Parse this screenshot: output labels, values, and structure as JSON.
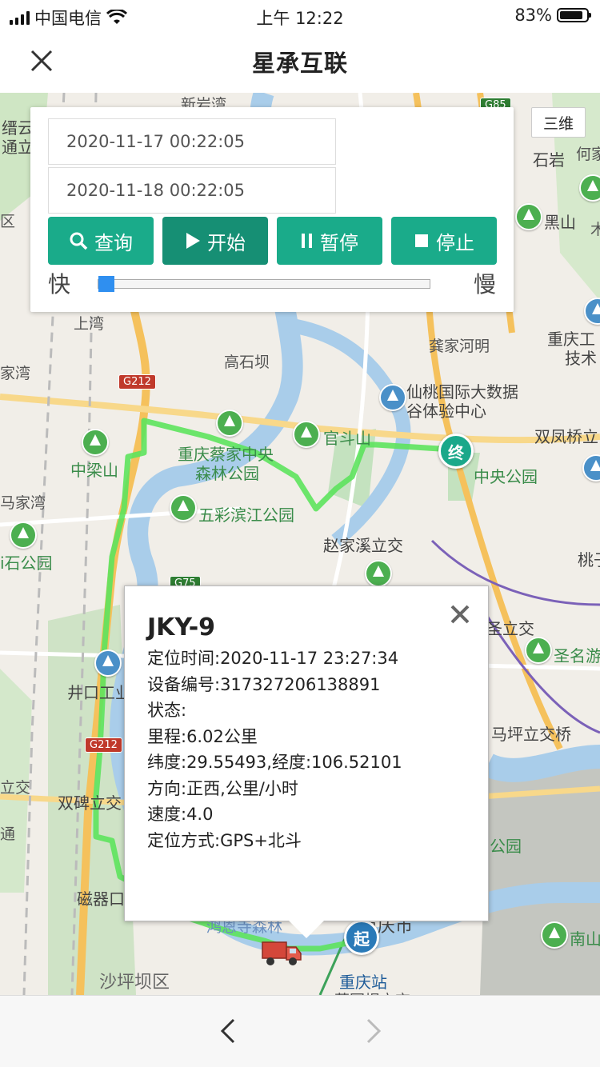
{
  "status_bar": {
    "carrier": "中国电信",
    "time": "上午 12:22",
    "battery": "83%"
  },
  "nav": {
    "title": "星承互联"
  },
  "map": {
    "labels": [
      "新岩湾",
      "缙云",
      "通立",
      "区",
      "上湾",
      "家湾",
      "高石坝",
      "龚家河明",
      "仙桃国际大数据",
      "谷体验中心",
      "双凤桥立",
      "重庆工",
      "技术",
      "石岩",
      "何家",
      "黑山",
      "木",
      "重庆蔡家中央",
      "森林公园",
      "官斗山",
      "中央公园",
      "中梁山",
      "马家湾",
      "五彩滨江公园",
      "赵家溪立交",
      "桃子",
      "i石公园",
      "井口工业",
      "圣名游",
      "马坪立交桥",
      "双碑立交",
      "磁器口",
      "公园",
      "南山",
      "重庆站",
      "沙坪坝区",
      "圣立交",
      "立交",
      "通",
      "鸿恩寺森林",
      "重庆市",
      "菜园坝立交"
    ],
    "road_tags": [
      "G85",
      "G212",
      "G75",
      "G212"
    ],
    "three_d_button": "三维",
    "start_marker": "起",
    "end_marker": "终"
  },
  "controls": {
    "start_time": "2020-11-17 00:22:05",
    "end_time": "2020-11-18 00:22:05",
    "buttons": [
      {
        "label": "查询",
        "icon": "search-icon"
      },
      {
        "label": "开始",
        "icon": "play-icon"
      },
      {
        "label": "暂停",
        "icon": "pause-icon"
      },
      {
        "label": "停止",
        "icon": "stop-icon"
      }
    ],
    "speed_fast": "快",
    "speed_slow": "慢",
    "speed_value": 0
  },
  "popup": {
    "title": "JKY-9",
    "lines": [
      "定位时间:2020-11-17 23:27:34",
      "设备编号:317327206138891",
      "状态:",
      "里程:6.02公里",
      "纬度:29.55493,经度:106.52101",
      "方向:正西,公里/小时",
      "速度:4.0",
      "定位方式:GPS+北斗"
    ]
  },
  "colors": {
    "accent": "#1aab8a",
    "route": "#5de35d",
    "slider": "#2f8ff0"
  }
}
